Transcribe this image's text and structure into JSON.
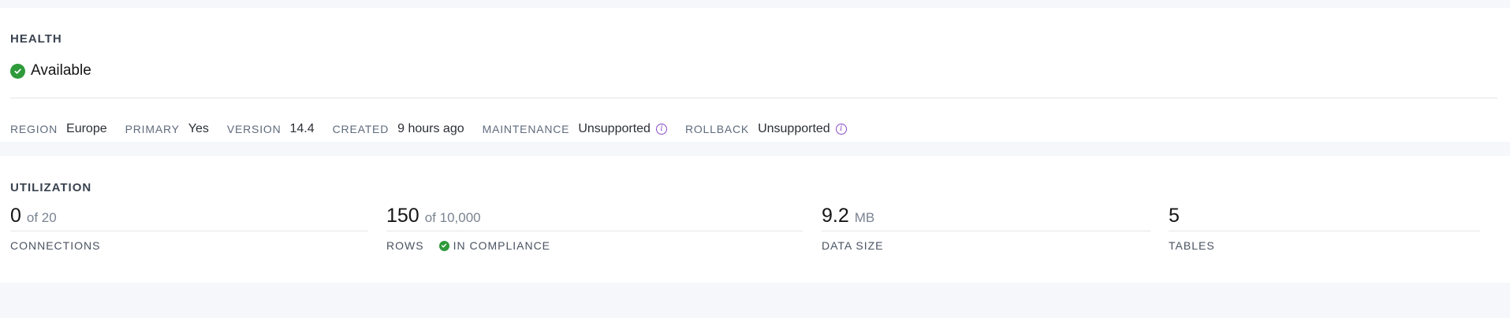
{
  "health": {
    "title": "HEALTH",
    "status": "Available",
    "meta": [
      {
        "label": "REGION",
        "value": "Europe",
        "info": false
      },
      {
        "label": "PRIMARY",
        "value": "Yes",
        "info": false
      },
      {
        "label": "VERSION",
        "value": "14.4",
        "info": false
      },
      {
        "label": "CREATED",
        "value": "9 hours ago",
        "info": false
      },
      {
        "label": "MAINTENANCE",
        "value": "Unsupported",
        "info": true
      },
      {
        "label": "ROLLBACK",
        "value": "Unsupported",
        "info": true
      }
    ]
  },
  "utilization": {
    "title": "UTILIZATION",
    "connections": {
      "value": "0",
      "sub": "of 20",
      "label": "CONNECTIONS"
    },
    "rows": {
      "value": "150",
      "sub": "of 10,000",
      "label": "ROWS",
      "compliance": "IN COMPLIANCE"
    },
    "data_size": {
      "value": "9.2",
      "sub": "MB",
      "label": "DATA SIZE"
    },
    "tables": {
      "value": "5",
      "label": "TABLES"
    }
  },
  "colors": {
    "success": "#2e9a3a",
    "info_accent": "#8a4cc8"
  },
  "icons": {
    "status": "check-circle-icon",
    "info": "info-circle-icon"
  }
}
